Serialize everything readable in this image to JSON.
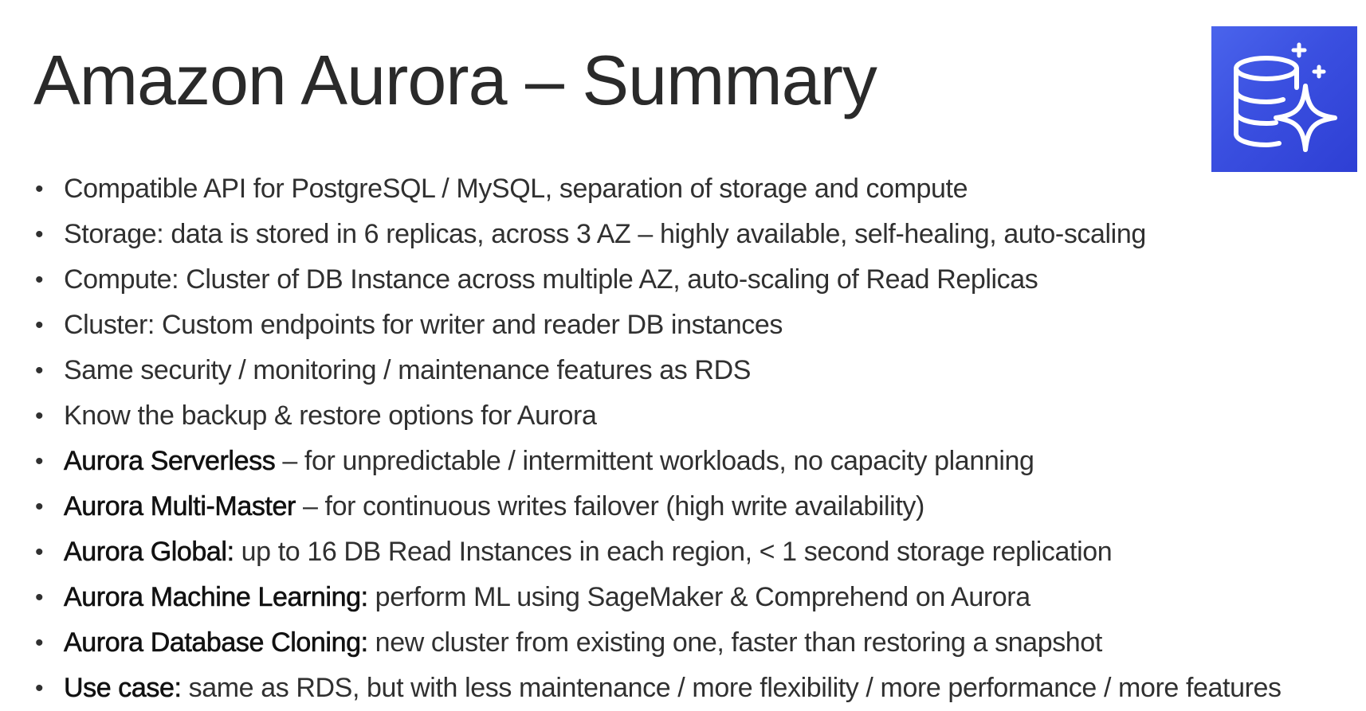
{
  "slide": {
    "title": "Amazon Aurora – Summary",
    "logo_icon": "aurora-database-sparkle-icon",
    "logo_color": "#3a4fe0",
    "bullet_glyph": "•",
    "bullets": [
      {
        "strong": "",
        "text": "Compatible API for PostgreSQL / MySQL, separation of storage and compute"
      },
      {
        "strong": "",
        "text": "Storage: data is stored in 6 replicas, across 3 AZ – highly available, self-healing, auto-scaling"
      },
      {
        "strong": "",
        "text": "Compute: Cluster of DB Instance across multiple AZ, auto-scaling of Read Replicas"
      },
      {
        "strong": "",
        "text": "Cluster: Custom endpoints for writer and reader DB instances"
      },
      {
        "strong": "",
        "text": "Same security / monitoring / maintenance features as RDS"
      },
      {
        "strong": "",
        "text": "Know the backup & restore options for Aurora"
      },
      {
        "strong": "Aurora Serverless",
        "text": " – for unpredictable / intermittent workloads, no capacity planning"
      },
      {
        "strong": "Aurora Multi-Master",
        "text": " – for continuous writes failover (high write availability)"
      },
      {
        "strong": "Aurora Global:",
        "text": " up to 16 DB Read Instances in each region, < 1 second storage replication"
      },
      {
        "strong": "Aurora Machine Learning:",
        "text": " perform ML using SageMaker & Comprehend on Aurora"
      },
      {
        "strong": "Aurora Database Cloning:",
        "text": " new cluster from existing one, faster than restoring a snapshot"
      },
      {
        "strong": "Use case:",
        "text": " same as RDS, but with less maintenance / more flexibility / more performance / more features"
      }
    ]
  }
}
